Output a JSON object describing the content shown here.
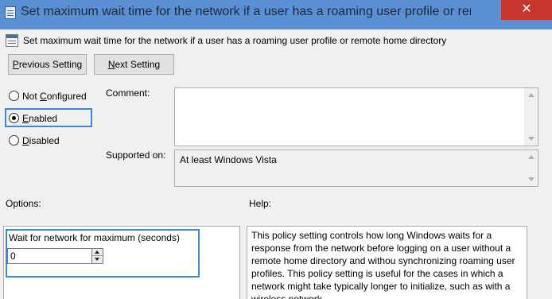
{
  "window": {
    "title": "Set maximum wait time for the network if a user has a roaming user profile or remo...",
    "close_glyph": "✕"
  },
  "heading": "Set maximum wait time for the network if a user has a roaming user profile or remote home directory",
  "buttons": {
    "previous": {
      "accel": "P",
      "rest": "revious Setting"
    },
    "next": {
      "accel": "N",
      "rest": "ext Setting"
    }
  },
  "radio": {
    "not_configured": {
      "before": "Not ",
      "accel": "C",
      "after": "onfigured",
      "checked": false
    },
    "enabled": {
      "before": "",
      "accel": "E",
      "after": "nabled",
      "checked": true
    },
    "disabled": {
      "before": "",
      "accel": "D",
      "after": "isabled",
      "checked": false
    }
  },
  "comment": {
    "label": "Comment:",
    "value": ""
  },
  "supported": {
    "label": "Supported on:",
    "value": "At least Windows Vista"
  },
  "options": {
    "label": "Options:",
    "wait_label": "Wait for network for maximum (seconds)",
    "wait_value": "0"
  },
  "help": {
    "label": "Help:",
    "text": "This policy setting controls how long Windows waits for a response from the network before logging on a user without a remote home directory and withou synchronizing roaming user profiles. This policy setting is useful for the cases in which a network might take typically longer to initialize, such as with a wireless network."
  },
  "colors": {
    "title_bar": "#5b8fd3",
    "close_button": "#c7352c",
    "focus": "#3b8ad9",
    "dialog_bg": "#f0f0f0"
  }
}
